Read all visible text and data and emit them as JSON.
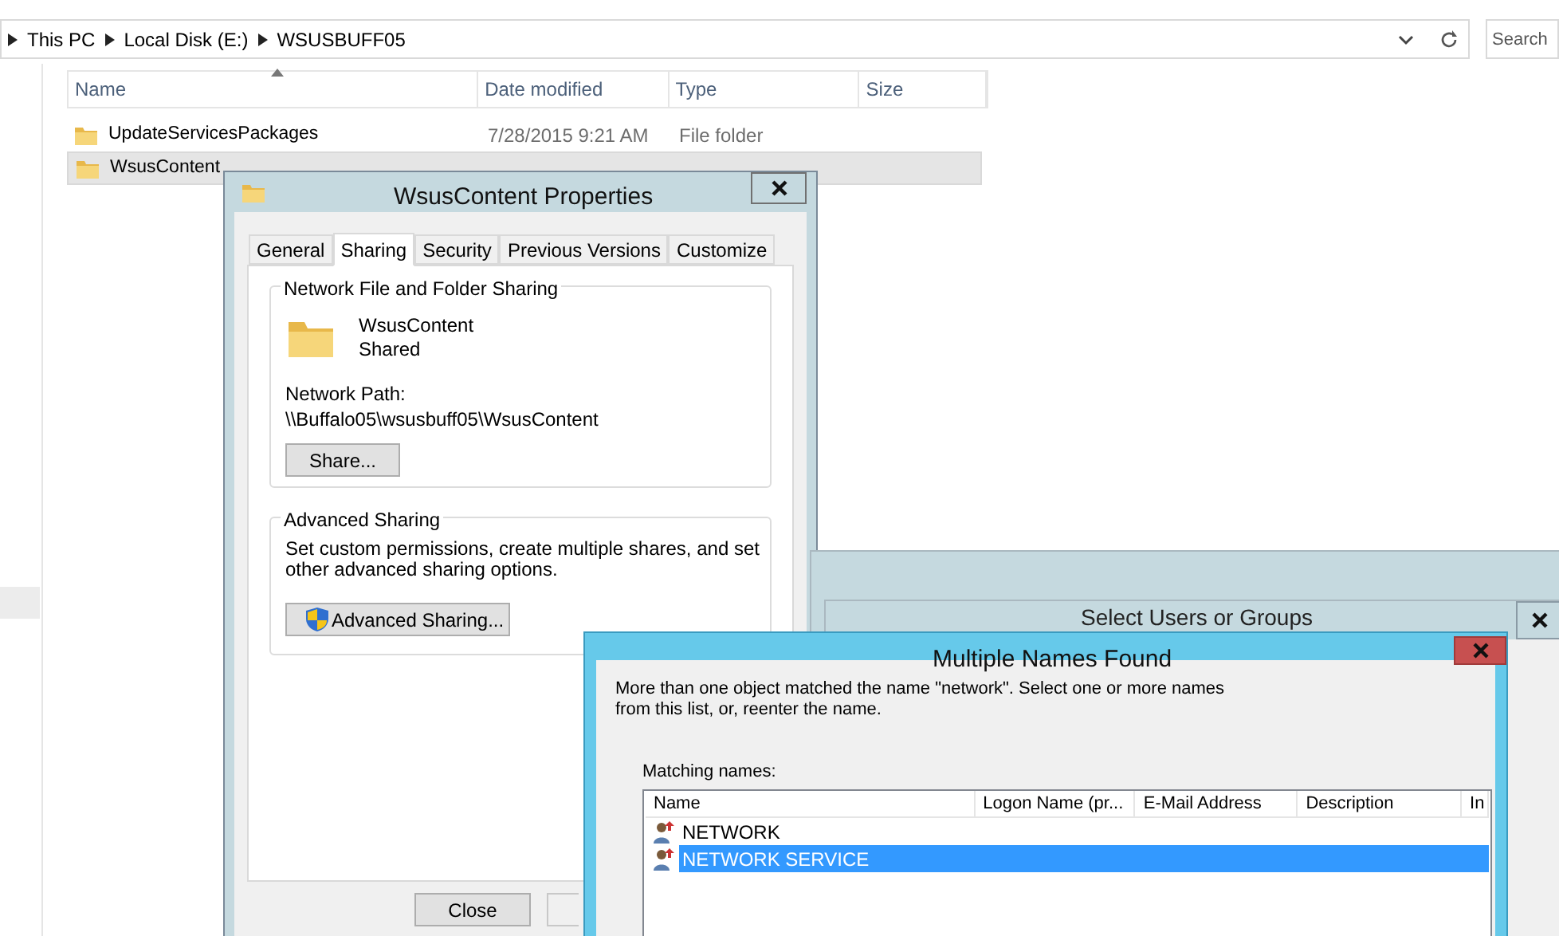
{
  "explorer": {
    "breadcrumb": [
      "This PC",
      "Local Disk (E:)",
      "WSUSBUFF05"
    ],
    "search": {
      "placeholder": "Search"
    },
    "columns": [
      "Name",
      "Date modified",
      "Type",
      "Size"
    ],
    "rows": [
      {
        "name": "UpdateServicesPackages",
        "date": "7/28/2015 9:21 AM",
        "type": "File folder",
        "selected": false
      },
      {
        "name": "WsusContent",
        "date": "",
        "type": "",
        "selected": true
      }
    ]
  },
  "properties": {
    "title": "WsusContent Properties",
    "tabs": [
      {
        "label": "General",
        "selected": false
      },
      {
        "label": "Sharing",
        "selected": true
      },
      {
        "label": "Security",
        "selected": false
      },
      {
        "label": "Previous Versions",
        "selected": false
      },
      {
        "label": "Customize",
        "selected": false
      }
    ],
    "network_sharing": {
      "title": "Network File and Folder Sharing",
      "folder": "WsusContent",
      "status": "Shared",
      "path_label": "Network Path:",
      "path": "\\\\Buffalo05\\wsusbuff05\\WsusContent",
      "button": "Share..."
    },
    "advanced_sharing": {
      "title": "Advanced Sharing",
      "description": "Set custom permissions, create multiple shares, and set other advanced sharing options.",
      "button": "Advanced Sharing..."
    },
    "buttons": [
      "Close"
    ]
  },
  "select_users": {
    "title": "Select Users or Groups"
  },
  "multiple_names": {
    "title": "Multiple Names Found",
    "message": "More than one object matched the name \"network\". Select one or more names\nfrom this list, or, reenter the name.",
    "list_label": "Matching names:",
    "columns": [
      "Name",
      "Logon Name (pr...",
      "E-Mail Address",
      "Description",
      "In"
    ],
    "rows": [
      {
        "name": "NETWORK",
        "selected": false
      },
      {
        "name": "NETWORK SERVICE",
        "selected": true
      }
    ]
  }
}
